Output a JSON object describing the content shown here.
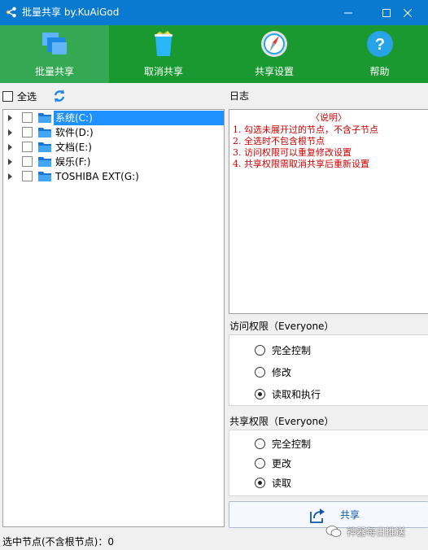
{
  "window": {
    "title": "批量共享 by.KuAiGod",
    "controls": [
      "minimize-icon",
      "maximize-icon",
      "close-icon"
    ],
    "title_bar_color": "#0a7ad1"
  },
  "toolbar": {
    "color": "#1a9930",
    "active_color": "#34a853",
    "items": [
      {
        "label": "批量共享",
        "icon": "share-folders-icon",
        "active": true
      },
      {
        "label": "取消共享",
        "icon": "trash-bin-icon",
        "active": false
      },
      {
        "label": "共享设置",
        "icon": "compass-icon",
        "active": false
      },
      {
        "label": "帮助",
        "icon": "help-icon",
        "active": false
      }
    ]
  },
  "left": {
    "select_all_label": "全选",
    "refresh_icon": "refresh-icon",
    "drives": [
      {
        "name": "系统(C:)",
        "selected": true,
        "checked": false
      },
      {
        "name": "软件(D:)",
        "selected": false,
        "checked": false
      },
      {
        "name": "文档(E:)",
        "selected": false,
        "checked": false
      },
      {
        "name": "娱乐(F:)",
        "selected": false,
        "checked": false
      },
      {
        "name": "TOSHIBA EXT(G:)",
        "selected": false,
        "checked": false
      }
    ]
  },
  "log": {
    "title": "日志",
    "heading": "〈说明〉",
    "lines": [
      "1. 勾选未展开过的节点，不含子节点",
      "2. 全选时不包含根节点",
      "3. 访问权限可以重复修改设置",
      "4. 共享权限需取消共享后重新设置"
    ],
    "text_color": "#cc0000"
  },
  "access": {
    "title": "访问权限（Everyone）",
    "options": [
      {
        "label": "完全控制",
        "checked": false
      },
      {
        "label": "修改",
        "checked": false
      },
      {
        "label": "读取和执行",
        "checked": true
      }
    ]
  },
  "share_perm": {
    "title": "共享权限（Everyone）",
    "options": [
      {
        "label": "完全控制",
        "checked": false
      },
      {
        "label": "更改",
        "checked": false
      },
      {
        "label": "读取",
        "checked": true
      }
    ]
  },
  "share_button": {
    "label": "共享",
    "icon": "share-arrow-icon"
  },
  "status": {
    "text": "选中节点(不含根节点)：0"
  },
  "watermark": {
    "text": "神器每日推送",
    "icon": "wechat-icon"
  }
}
